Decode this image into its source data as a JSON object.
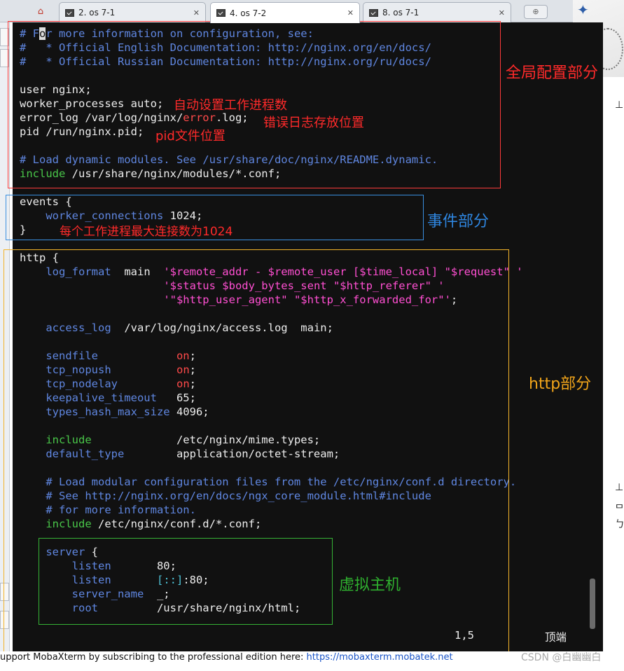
{
  "tabs": [
    {
      "label": "2. os 7-1",
      "active": false
    },
    {
      "label": "4. os 7-2",
      "active": true
    },
    {
      "label": "8. os 7-1",
      "active": false
    }
  ],
  "lines": [
    [
      {
        "t": "# F",
        "c": "c"
      },
      {
        "t": "o",
        "c": "cursor"
      },
      {
        "t": "r more information on configuration, see:",
        "c": "c"
      }
    ],
    [
      {
        "t": "#   * Official English Documentation: http://nginx.org/en/docs/",
        "c": "c"
      }
    ],
    [
      {
        "t": "#   * Official Russian Documentation: http://nginx.org/ru/docs/",
        "c": "c"
      }
    ],
    [],
    [
      {
        "t": "user nginx;"
      }
    ],
    [
      {
        "t": "worker_processes auto;"
      }
    ],
    [
      {
        "t": "error_log /var/log/nginx/"
      },
      {
        "t": "error",
        "c": "r"
      },
      {
        "t": ".log;"
      }
    ],
    [
      {
        "t": "pid /run/nginx.pid;"
      }
    ],
    [],
    [
      {
        "t": "# Load dynamic modules. See /usr/share/doc/nginx/README.dynamic.",
        "c": "c"
      }
    ],
    [
      {
        "t": "include",
        "c": "g"
      },
      {
        "t": " /usr/share/nginx/modules/*.conf;"
      }
    ],
    [],
    [
      {
        "t": "events {"
      }
    ],
    [
      {
        "t": "    "
      },
      {
        "t": "worker_connections",
        "c": "c"
      },
      {
        "t": " 1024;"
      }
    ],
    [
      {
        "t": "}"
      }
    ],
    [],
    [
      {
        "t": "http {"
      }
    ],
    [
      {
        "t": "    "
      },
      {
        "t": "log_format",
        "c": "c"
      },
      {
        "t": "  main  "
      },
      {
        "t": "'$remote_addr - $remote_user [$time_local] \"$request\" '",
        "c": "m"
      }
    ],
    [
      {
        "t": "                      "
      },
      {
        "t": "'$status $body_bytes_sent \"$http_referer\" '",
        "c": "m"
      }
    ],
    [
      {
        "t": "                      "
      },
      {
        "t": "'\"$http_user_agent\" \"$http_x_forwarded_for\"'",
        "c": "m"
      },
      {
        "t": ";"
      }
    ],
    [],
    [
      {
        "t": "    "
      },
      {
        "t": "access_log",
        "c": "c"
      },
      {
        "t": "  /var/log/nginx/access.log  main;"
      }
    ],
    [],
    [
      {
        "t": "    "
      },
      {
        "t": "sendfile",
        "c": "c"
      },
      {
        "t": "            "
      },
      {
        "t": "on",
        "c": "r"
      },
      {
        "t": ";"
      }
    ],
    [
      {
        "t": "    "
      },
      {
        "t": "tcp_nopush",
        "c": "c"
      },
      {
        "t": "          "
      },
      {
        "t": "on",
        "c": "r"
      },
      {
        "t": ";"
      }
    ],
    [
      {
        "t": "    "
      },
      {
        "t": "tcp_nodelay",
        "c": "c"
      },
      {
        "t": "         "
      },
      {
        "t": "on",
        "c": "r"
      },
      {
        "t": ";"
      }
    ],
    [
      {
        "t": "    "
      },
      {
        "t": "keepalive_timeout",
        "c": "c"
      },
      {
        "t": "   65;"
      }
    ],
    [
      {
        "t": "    "
      },
      {
        "t": "types_hash_max_size",
        "c": "c"
      },
      {
        "t": " 4096;"
      }
    ],
    [],
    [
      {
        "t": "    "
      },
      {
        "t": "include",
        "c": "g"
      },
      {
        "t": "             /etc/nginx/mime.types;"
      }
    ],
    [
      {
        "t": "    "
      },
      {
        "t": "default_type",
        "c": "c"
      },
      {
        "t": "        application/octet-stream;"
      }
    ],
    [],
    [
      {
        "t": "    # Load modular configuration files from the /etc/nginx/conf.d directory.",
        "c": "c"
      }
    ],
    [
      {
        "t": "    # See http://nginx.org/en/docs/ngx_core_module.html#include",
        "c": "c"
      }
    ],
    [
      {
        "t": "    # for more information.",
        "c": "c"
      }
    ],
    [
      {
        "t": "    "
      },
      {
        "t": "include",
        "c": "g"
      },
      {
        "t": " /etc/nginx/conf.d/*.conf;"
      }
    ],
    [],
    [
      {
        "t": "    "
      },
      {
        "t": "server",
        "c": "c"
      },
      {
        "t": " {"
      }
    ],
    [
      {
        "t": "        "
      },
      {
        "t": "listen",
        "c": "c"
      },
      {
        "t": "       80;"
      }
    ],
    [
      {
        "t": "        "
      },
      {
        "t": "listen",
        "c": "c"
      },
      {
        "t": "       "
      },
      {
        "t": "[::]",
        "c": "cy"
      },
      {
        "t": ":80;"
      }
    ],
    [
      {
        "t": "        "
      },
      {
        "t": "server_name",
        "c": "c"
      },
      {
        "t": "  _;"
      }
    ],
    [
      {
        "t": "        "
      },
      {
        "t": "root",
        "c": "c"
      },
      {
        "t": "         /usr/share/nginx/html;"
      }
    ]
  ],
  "status": {
    "position": "1,5",
    "scroll": "顶端"
  },
  "annotations": {
    "global_section": "全局配置部分",
    "auto_workers": "自动设置工作进程数",
    "error_log_note": "错误日志存放位置",
    "pid_note": "pid文件位置",
    "events_section": "事件部分",
    "max_conn_note": "每个工作进程最大连接数为1024",
    "http_section": "http部分",
    "vhost_section": "虚拟主机"
  },
  "footer": {
    "support_text": "upport MobaXterm by subscribing to the professional edition here: ",
    "link": "https://mobaxterm.mobatek.net",
    "watermark": "CSDN @白幽幽白"
  },
  "colors": {
    "terminal_bg": "#111111",
    "global_box": "#ff3b3b",
    "events_box": "#3a8fe0",
    "http_box": "#f2b32a",
    "vhost_box": "#36b336"
  }
}
